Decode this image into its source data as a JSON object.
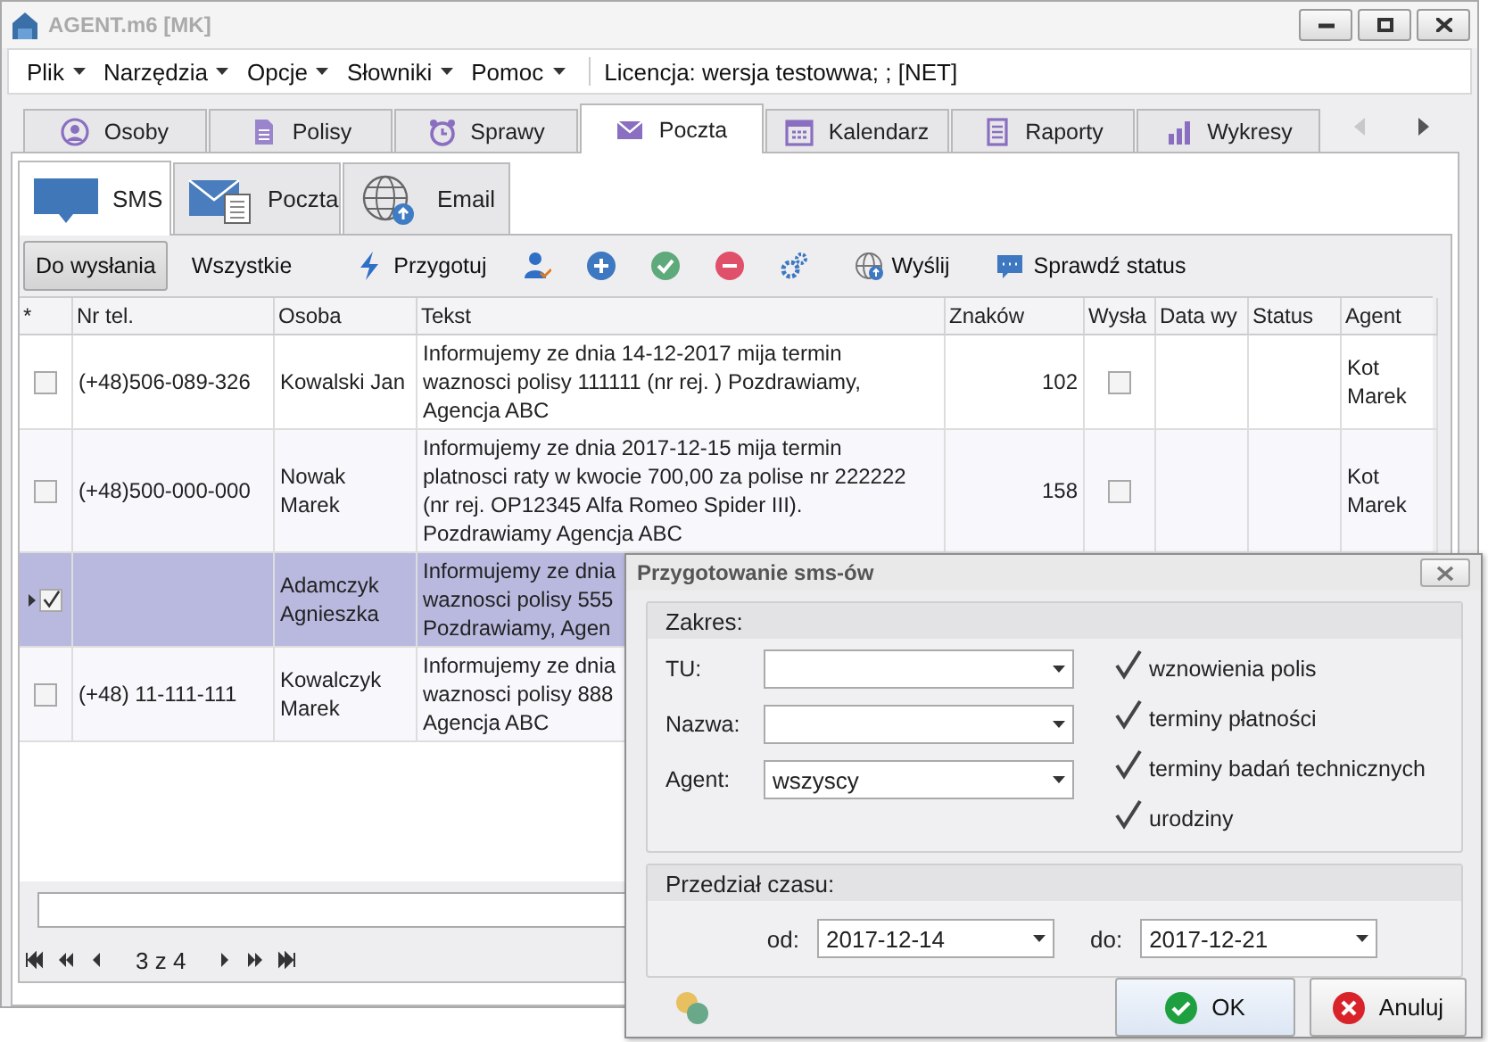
{
  "window": {
    "title": "AGENT.m6 [MK]"
  },
  "menu": [
    {
      "label": "Plik"
    },
    {
      "label": "Narzędzia"
    },
    {
      "label": "Opcje"
    },
    {
      "label": "Słowniki"
    },
    {
      "label": "Pomoc"
    }
  ],
  "license": "Licencja: wersja testowwa; ;  [NET]",
  "tabs": [
    {
      "label": "Osoby",
      "selected": false
    },
    {
      "label": "Polisy",
      "selected": false
    },
    {
      "label": "Sprawy",
      "selected": false
    },
    {
      "label": "Poczta",
      "selected": true
    },
    {
      "label": "Kalendarz",
      "selected": false
    },
    {
      "label": "Raporty",
      "selected": false
    },
    {
      "label": "Wykresy",
      "selected": false
    }
  ],
  "sub_tabs": [
    {
      "label": "SMS",
      "selected": true
    },
    {
      "label": "Poczta",
      "selected": false
    },
    {
      "label": "Email",
      "selected": false
    }
  ],
  "filters": [
    {
      "label": "Do wysłania",
      "selected": true
    },
    {
      "label": "Wszystkie",
      "selected": false
    }
  ],
  "toolbar": [
    {
      "kind": "prepare",
      "label": "Przygotuj"
    },
    {
      "kind": "assign"
    },
    {
      "kind": "add"
    },
    {
      "kind": "approve"
    },
    {
      "kind": "remove"
    },
    {
      "kind": "settings"
    },
    {
      "kind": "send",
      "label": "Wyślij"
    },
    {
      "kind": "status",
      "label": "Sprawdź status"
    }
  ],
  "grid": {
    "columns": [
      "*",
      "Nr tel.",
      "Osoba",
      "Tekst",
      "Znaków",
      "Wysła",
      "Data wy",
      "Status",
      "Agent"
    ],
    "rows": [
      {
        "selected": false,
        "checked": false,
        "phone": "(+48)506-089-326",
        "person": "Kowalski Jan",
        "text_lines": [
          "Informujemy ze dnia 14-12-2017 mija termin",
          "waznosci polisy 111111 (nr rej.  ) Pozdrawiamy,",
          "Agencja ABC"
        ],
        "chars": "102",
        "sent": false,
        "agent": "Kot Marek"
      },
      {
        "selected": false,
        "checked": false,
        "phone": "(+48)500-000-000",
        "person": "Nowak Marek",
        "text_lines": [
          "Informujemy ze dnia 2017-12-15 mija termin",
          "platnosci raty w kwocie 700,00 za polise nr 222222",
          "(nr rej. OP12345 Alfa Romeo Spider III).",
          "Pozdrawiamy Agencja ABC"
        ],
        "chars": "158",
        "sent": false,
        "agent": "Kot Marek"
      },
      {
        "selected": true,
        "checked": true,
        "person": "Adamczyk Agnieszka",
        "text_lines": [
          "Informujemy ze dnia",
          "waznosci polisy 555",
          "Pozdrawiamy, Agen"
        ]
      },
      {
        "selected": false,
        "checked": false,
        "phone": "(+48) 11-111-111",
        "person": "Kowalczyk Marek",
        "text_lines": [
          "Informujemy ze dnia",
          "waznosci polisy 888",
          "Agencja ABC"
        ]
      }
    ]
  },
  "pager": {
    "label": "3 z 4"
  },
  "dialog": {
    "title": "Przygotowanie sms-ów",
    "scope": {
      "title": "Zakres:",
      "fields": [
        {
          "label": "TU:"
        },
        {
          "label": "Nazwa:"
        },
        {
          "label": "Agent:",
          "value": "wszyscy"
        }
      ],
      "options": [
        {
          "label": "wznowienia polis",
          "checked": true
        },
        {
          "label": "terminy płatności",
          "checked": true
        },
        {
          "label": "terminy badań technicznych",
          "checked": true
        },
        {
          "label": "urodziny",
          "checked": true
        }
      ]
    },
    "period": {
      "title": "Przedział czasu:",
      "from_label": "od:",
      "from": "2017-12-14",
      "to_label": "do:",
      "to": "2017-12-21"
    },
    "buttons": [
      {
        "kind": "ok",
        "label": "OK"
      },
      {
        "kind": "cancel",
        "label": "Anuluj"
      }
    ]
  }
}
